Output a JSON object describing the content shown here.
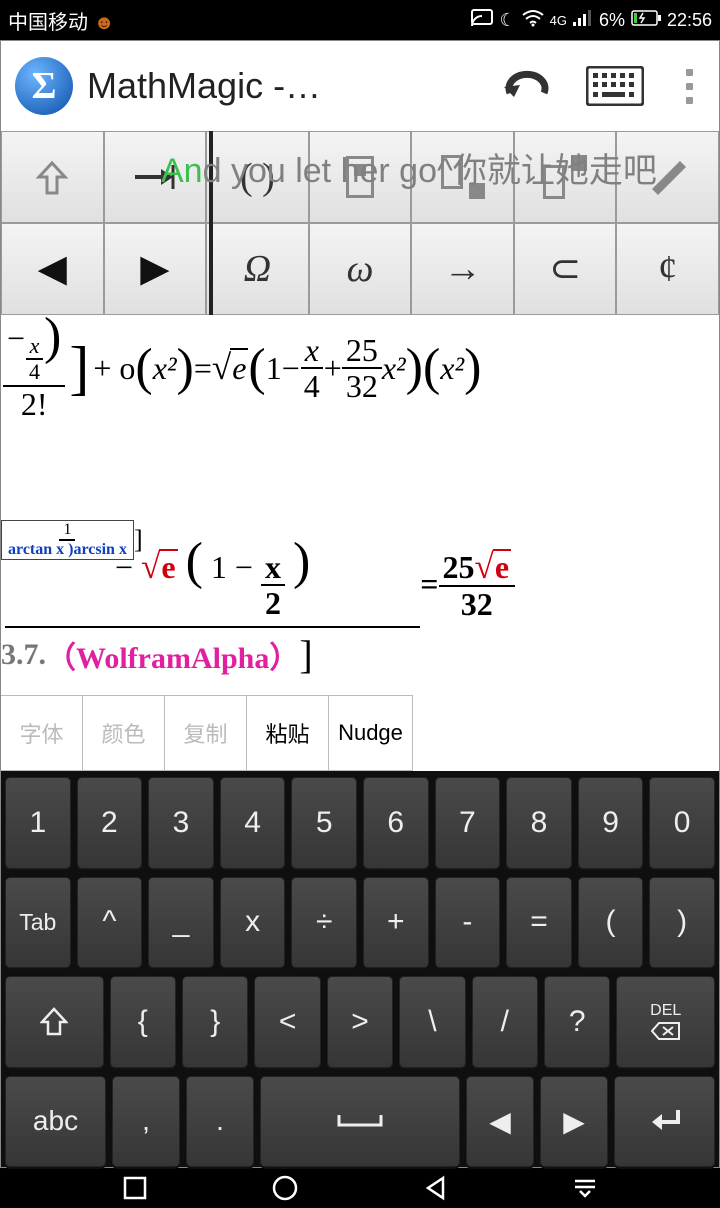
{
  "status": {
    "carrier": "中国移动",
    "battery_pct": "6%",
    "time": "22:56",
    "net": "4G"
  },
  "header": {
    "logo_letter": "Σ",
    "title": "MathMagic  -…"
  },
  "overlay": {
    "prefix": "An",
    "rest": "d you let her go^你就让她走吧"
  },
  "toolbar": {
    "row2": {
      "omega_upper": "Ω",
      "omega_lower": "ω",
      "arrow": "→",
      "subset": "⊂",
      "notin": "¢"
    }
  },
  "equation1": {
    "frac1_num_inner_num": "x",
    "frac1_num_inner_den": "4",
    "frac1_den": "2!",
    "plus_o": "+ o",
    "x2": "x²",
    "eq": " = ",
    "sqrt_e": "e",
    "one": "1",
    "minus": " − ",
    "f2_num": "x",
    "f2_den": "4",
    "plus": " + ",
    "f3_num": "25",
    "f3_den": "32",
    "tail": "x²",
    "tail2": "x²"
  },
  "equation2": {
    "exp_num": "1",
    "small": "arctan x )arcsin x"
  },
  "equation3": {
    "minus": "− ",
    "sqrt_e": "e",
    "one": "1",
    "fnum": "x",
    "fden": "2",
    "eq": " = ",
    "r_num_a": "25",
    "r_num_b": "e",
    "r_den": "32"
  },
  "equation4": {
    "num": "3.7.",
    "wolfram": "（WolframAlpha）"
  },
  "context_menu": [
    "字体",
    "颜色",
    "复制",
    "粘贴",
    "Nudge"
  ],
  "keyboard": {
    "r1": [
      "1",
      "2",
      "3",
      "4",
      "5",
      "6",
      "7",
      "8",
      "9",
      "0"
    ],
    "r2": [
      "Tab",
      "^",
      "_",
      "x",
      "÷",
      "+",
      "-",
      "=",
      "(",
      ")"
    ],
    "r3": [
      "⇧",
      "{",
      "}",
      "<",
      ">",
      "\\",
      "/",
      "?",
      "DEL"
    ],
    "r4": [
      "abc",
      ",",
      ".",
      "␣",
      "◀",
      "▶",
      "↵"
    ]
  }
}
